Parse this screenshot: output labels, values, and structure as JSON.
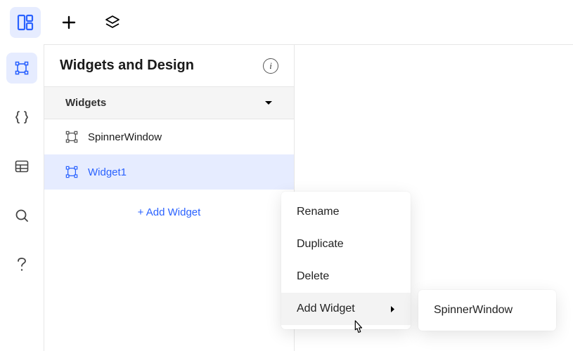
{
  "topbar": {
    "items": [
      {
        "name": "design-mode-icon",
        "active": true
      },
      {
        "name": "add-icon",
        "active": false
      },
      {
        "name": "layers-icon",
        "active": false
      }
    ]
  },
  "siderail": {
    "items": [
      {
        "name": "widget-bounds-icon",
        "active": true
      },
      {
        "name": "braces-icon",
        "active": false
      },
      {
        "name": "table-icon",
        "active": false
      },
      {
        "name": "search-icon",
        "active": false
      },
      {
        "name": "help-icon",
        "active": false
      }
    ]
  },
  "panel": {
    "title": "Widgets and Design",
    "section_label": "Widgets",
    "items": [
      {
        "name": "SpinnerWindow",
        "active": false
      },
      {
        "name": "Widget1",
        "active": true
      }
    ],
    "add_widget_label": "+ Add Widget"
  },
  "context_menu": {
    "items": [
      {
        "label": "Rename",
        "submenu": false,
        "hovered": false
      },
      {
        "label": "Duplicate",
        "submenu": false,
        "hovered": false
      },
      {
        "label": "Delete",
        "submenu": false,
        "hovered": false
      },
      {
        "label": "Add Widget",
        "submenu": true,
        "hovered": true
      }
    ]
  },
  "submenu": {
    "items": [
      {
        "label": "SpinnerWindow"
      }
    ]
  }
}
